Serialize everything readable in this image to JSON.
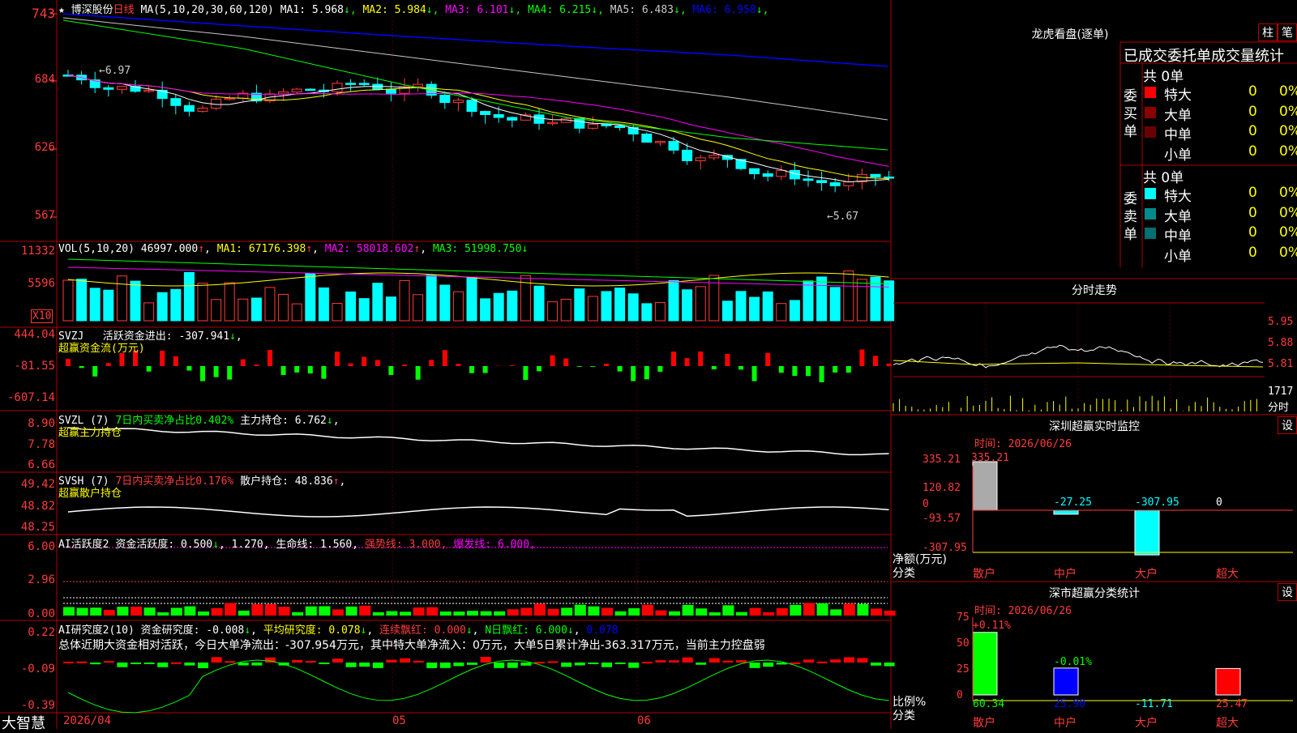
{
  "stock": {
    "name": "博深股份",
    "period": "日线",
    "ma_label": "MA(5,10,20,30,60,120)",
    "ma": [
      {
        "label": "MA1:",
        "value": "5.968",
        "arrow": "↓",
        "color": "#ffffff"
      },
      {
        "label": "MA2:",
        "value": "5.984",
        "arrow": "↓",
        "color": "#ffff00"
      },
      {
        "label": "MA3:",
        "value": "6.101",
        "arrow": "↓",
        "color": "#ff00ff"
      },
      {
        "label": "MA4:",
        "value": "6.215",
        "arrow": "↓",
        "color": "#00ff00"
      },
      {
        "label": "MA5:",
        "value": "6.483",
        "arrow": "↓",
        "color": "#c8c8c8"
      },
      {
        "label": "MA6:",
        "value": "6.958",
        "arrow": "↓",
        "color": "#0000ff"
      }
    ],
    "price_axis": [
      "743",
      "684",
      "626",
      "567"
    ],
    "high_marker": "←6.97",
    "low_marker": "←5.67"
  },
  "vol": {
    "header": "VOL(5,10,20)",
    "value": "46997.000",
    "ma1": "67176.398",
    "ma2": "58018.602",
    "ma3": "51998.750",
    "axis": [
      "11332",
      "5596"
    ],
    "unit": "X10"
  },
  "svzj": {
    "title": "SVZJ",
    "label": "活跃资金进出:",
    "value": "-307.941",
    "sub": "超赢资金流(万元)",
    "axis": [
      "444.04",
      "-81.55",
      "-607.14"
    ]
  },
  "svzl": {
    "title": "SVZL (7)",
    "text1": "7日内买卖净占比0.402%",
    "text2": "主力持仓: 6.762",
    "sub": "超赢主力持仓",
    "axis": [
      "8.90",
      "7.78",
      "6.66"
    ]
  },
  "svsh": {
    "title": "SVSH (7)",
    "text1": "7日内买卖净占比0.176%",
    "text2": "散户持仓: 48.836",
    "sub": "超赢散户持仓",
    "axis": [
      "49.42",
      "48.82",
      "48.25"
    ]
  },
  "ai_active": {
    "title": "AI活跃度2",
    "label": "资金活跃度: 0.500",
    "v2": "1.270,",
    "life": "生命线: 1.560,",
    "strong": "强势线: 3.000,",
    "burst": "爆发线: 6.000,",
    "axis": [
      "6.00",
      "2.96",
      "0.00"
    ]
  },
  "ai_research": {
    "title": "AI研究度2(10)",
    "label": "资金研究度: -0.008",
    "avg": "平均研究度: 0.078",
    "cont": "连续飘红: 0.000",
    "nday": "N日飘红: 6.000",
    "last": "0.078",
    "summary": "总体近期大资金相对活跃，今日大单净流出：-307.954万元，其中特大单净流入：0万元，大单5日累计净出-363.317万元，当前主力控盘弱",
    "axis": [
      "0.22",
      "-0.09",
      "-0.39"
    ]
  },
  "footer": {
    "brand": "大智慧",
    "date_start": "2026/04",
    "m05": "05",
    "m06": "06"
  },
  "longhu": {
    "title": "龙虎看盘(逐单)",
    "btn1": "柱",
    "btn2": "笔",
    "subtitle": "已成交委托单成交量统计",
    "buy_label": "委买单",
    "sell_label": "委卖单",
    "buy_total": "共 0单",
    "sell_total": "共 0单",
    "rows_buy": [
      {
        "name": "特大",
        "count": "0",
        "pct": "0%",
        "color": "#ff0000"
      },
      {
        "name": "大单",
        "count": "0",
        "pct": "0%",
        "color": "#8b0000"
      },
      {
        "name": "中单",
        "count": "0",
        "pct": "0%",
        "color": "#6b0000"
      },
      {
        "name": "小单",
        "count": "0",
        "pct": "0%",
        "color": "#000000"
      }
    ],
    "rows_sell": [
      {
        "name": "特大",
        "count": "0",
        "pct": "0%",
        "color": "#00ffff"
      },
      {
        "name": "大单",
        "count": "0",
        "pct": "0%",
        "color": "#008b8b"
      },
      {
        "name": "中单",
        "count": "0",
        "pct": "0%",
        "color": "#007070"
      },
      {
        "name": "小单",
        "count": "0",
        "pct": "0%",
        "color": "#000000"
      }
    ]
  },
  "intraday": {
    "title": "分时走势",
    "axis": [
      "5.95",
      "5.88",
      "5.81"
    ],
    "vol_label": "1717",
    "time_label": "分时"
  },
  "monitor": {
    "title": "深圳超赢实时监控",
    "btn": "设",
    "time": "时间: 2026/06/26",
    "axis": [
      "335.21",
      "120.82",
      "0",
      "-93.57",
      "-307.95"
    ],
    "ylabel": "净额(万元)",
    "xlabel": "分类",
    "categories": [
      "散户",
      "中户",
      "大户",
      "超大"
    ],
    "values": [
      335.21,
      -27.25,
      -307.95,
      0
    ],
    "value_labels": [
      "335.21",
      "-27.25",
      "-307.95",
      "0"
    ]
  },
  "classify": {
    "title": "深市超赢分类统计",
    "btn": "设",
    "time": "时间: 2026/06/26",
    "axis": [
      "75",
      "50",
      "25",
      "0"
    ],
    "ylabel": "比例%",
    "xlabel": "分类",
    "categories": [
      "散户",
      "中户",
      "大户",
      "超大"
    ],
    "values": [
      60.34,
      25.9,
      -11.71,
      25.47
    ],
    "value_labels": [
      "60.34",
      "25.90",
      "-11.71",
      "25.47"
    ],
    "delta_labels": [
      "+0.11%",
      "-0.01%"
    ]
  }
}
